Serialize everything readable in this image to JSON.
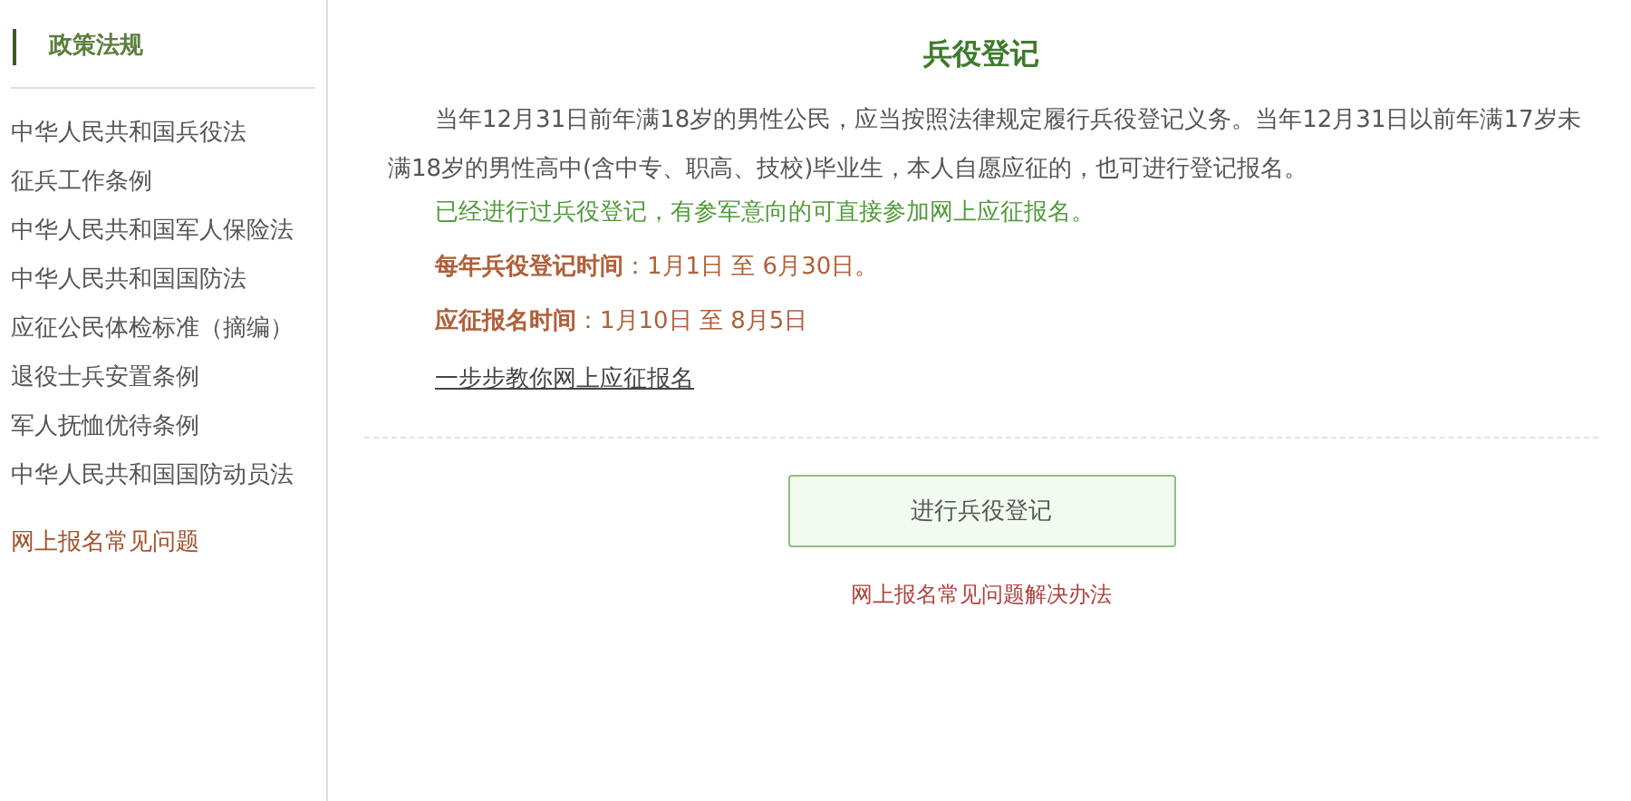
{
  "sidebar": {
    "heading": "政策法规",
    "items": [
      {
        "label": "中华人民共和国兵役法",
        "kind": "law"
      },
      {
        "label": "征兵工作条例",
        "kind": "law"
      },
      {
        "label": "中华人民共和国军人保险法",
        "kind": "law"
      },
      {
        "label": "中华人民共和国国防法",
        "kind": "law"
      },
      {
        "label": "应征公民体检标准（摘编）",
        "kind": "law"
      },
      {
        "label": "退役士兵安置条例",
        "kind": "law"
      },
      {
        "label": "军人抚恤优待条例",
        "kind": "law"
      },
      {
        "label": "中华人民共和国国防动员法",
        "kind": "law"
      },
      {
        "label": "网上报名常见问题",
        "kind": "faq"
      }
    ]
  },
  "main": {
    "title": "兵役登记",
    "paragraphs": [
      {
        "kind": "plain",
        "text": "当年12月31日前年满18岁的男性公民，应当按照法律规定履行兵役登记义务。当年12月31日以前年满17岁未满18岁的男性高中(含中专、职高、技校)毕业生，本人自愿应征的，也可进行登记报名。"
      },
      {
        "kind": "note",
        "text": "已经进行过兵役登记，有参军意向的可直接参加网上应征报名。"
      },
      {
        "kind": "schedule",
        "text": "**每年兵役登记时间**：1月1日 至 6月30日。"
      },
      {
        "kind": "schedule",
        "text": "**应征报名时间**：1月10日 至 8月5日"
      },
      {
        "kind": "link",
        "text": "一步步教你网上应征报名"
      }
    ],
    "register_button": "进行兵役登记",
    "faq_link": "网上报名常见问题解决办法"
  }
}
